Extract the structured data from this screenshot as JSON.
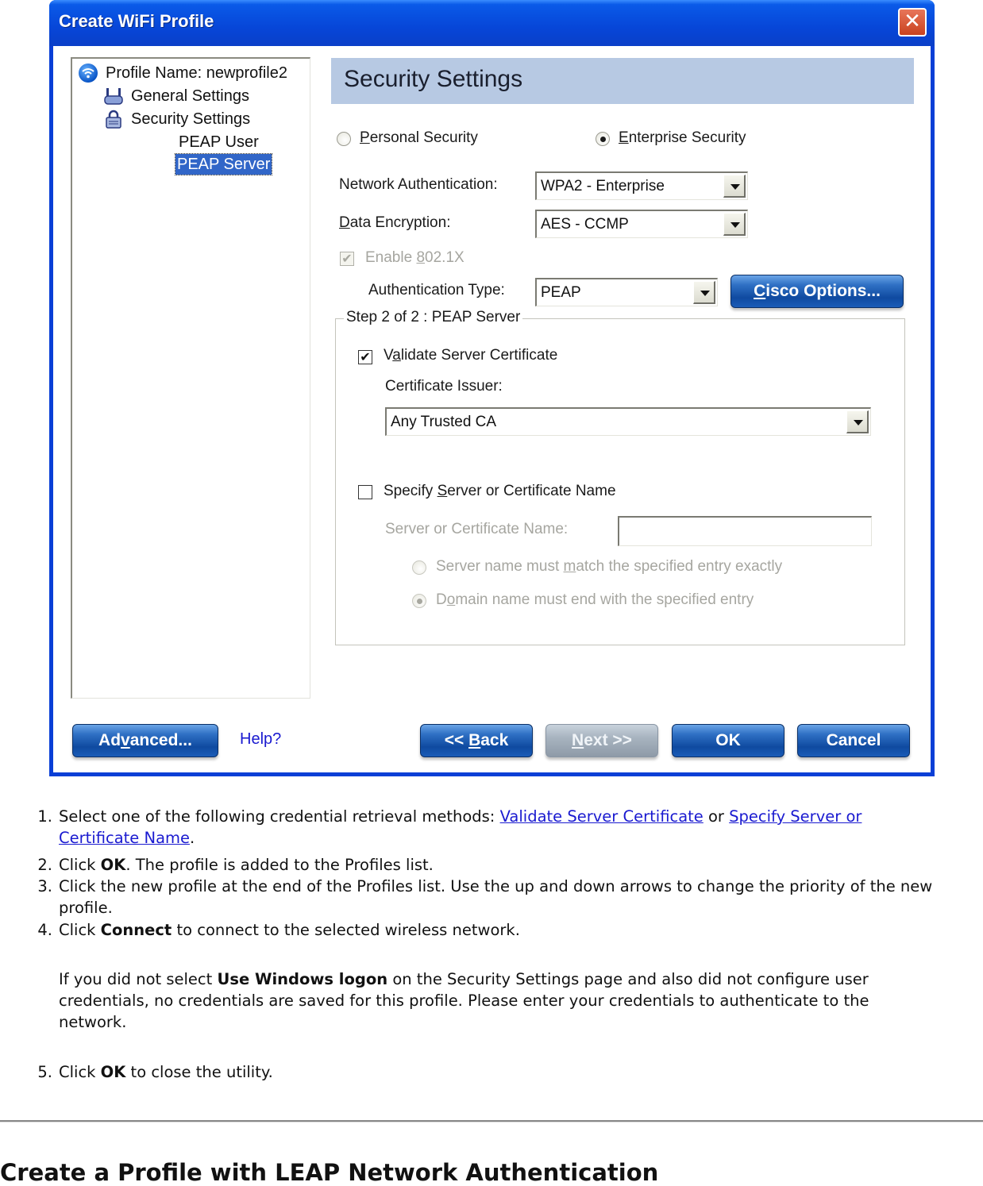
{
  "dialog": {
    "title": "Create WiFi Profile",
    "close_label": "✕",
    "tree": {
      "profile_name": "Profile Name: newprofile2",
      "items": [
        {
          "label": "General Settings",
          "icon": "router-icon"
        },
        {
          "label": "Security Settings",
          "icon": "lock-icon"
        },
        {
          "label": "PEAP User"
        },
        {
          "label": "PEAP Server",
          "selected": true
        }
      ]
    },
    "header": "Security Settings",
    "security_mode": {
      "personal_label_pre": "",
      "personal_access": "P",
      "personal_label_post": "ersonal Security",
      "enterprise_access": "E",
      "enterprise_label_post": "nterprise Security",
      "selected": "Enterprise Security"
    },
    "network_auth": {
      "label": "Network Authentication:",
      "value": "WPA2 - Enterprise"
    },
    "data_encryption": {
      "label_access": "D",
      "label_rest": "ata Encryption:",
      "value": "AES - CCMP"
    },
    "enable_8021x": {
      "label_pre": "Enable ",
      "label_access": "8",
      "label_post": "02.1X",
      "checked": true,
      "disabled": true
    },
    "auth_type": {
      "label": "Authentication Type:",
      "value": "PEAP"
    },
    "cisco_options": {
      "access": "C",
      "rest": "isco Options..."
    },
    "group": {
      "legend": "Step 2 of 2 : PEAP Server",
      "validate_cert": {
        "pre": "V",
        "access": "a",
        "post": "lidate Server Certificate",
        "checked": true
      },
      "cert_issuer_label": "Certificate Issuer:",
      "cert_issuer_value": "Any Trusted CA",
      "specify_server": {
        "pre": "Specify ",
        "access": "S",
        "post": "erver or Certificate Name",
        "checked": false
      },
      "server_name_label": "Server or Certificate Name:",
      "server_name_value": "",
      "match_exact": {
        "pre": "Server name must ",
        "access": "m",
        "post": "atch the specified entry exactly",
        "selected": false
      },
      "domain_end": {
        "pre": "D",
        "access": "o",
        "post": "main name must end with the specified entry",
        "selected": true
      }
    },
    "buttons": {
      "advanced": {
        "pre": "Ad",
        "access": "v",
        "post": "anced..."
      },
      "help": "Help?",
      "back": {
        "pre": "<< ",
        "access": "B",
        "post": "ack"
      },
      "next": {
        "access": "N",
        "post": "ext >>"
      },
      "ok": "OK",
      "cancel": "Cancel"
    }
  },
  "steps": [
    {
      "num": "1.",
      "pre": "Select one of the following credential retrieval methods: ",
      "link1": "Validate Server Certificate",
      "mid": " or ",
      "link2": "Specify Server or Certificate Name",
      "post": "."
    },
    {
      "num": "2.",
      "pre": "Click ",
      "bold": "OK",
      "post": ". The profile is added to the Profiles list."
    },
    {
      "num": "3.",
      "text": "Click the new profile at the end of the Profiles list. Use the up and down arrows to change the priority of the new profile."
    },
    {
      "num": "4.",
      "pre": "Click ",
      "bold": "Connect",
      "post": " to connect to the selected wireless network."
    },
    {
      "num": "5.",
      "pre": "Click ",
      "bold": "OK",
      "post": " to close the utility."
    }
  ],
  "note": {
    "pre": "If you did not select ",
    "bold": "Use Windows logon",
    "post": " on the Security Settings page and also did not configure user credentials, no credentials are saved for this profile. Please enter your credentials to authenticate to the network."
  },
  "section_heading": "Create a Profile with LEAP Network Authentication",
  "colors": {
    "title_bar": "#0746d8",
    "header_bar": "#b7c9e3",
    "selection": "#3166c8",
    "link": "#1a1ad0",
    "button": "#0f4aa0"
  }
}
